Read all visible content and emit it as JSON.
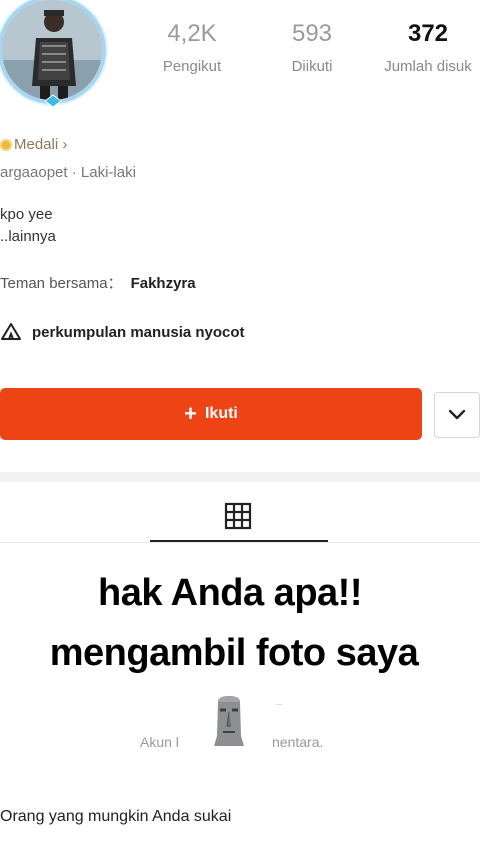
{
  "profile": {
    "stats": [
      {
        "value": "4,2K",
        "label": "Pengikut"
      },
      {
        "value": "593",
        "label": "Diikuti"
      },
      {
        "value": "372",
        "label": "Jumlah disuk"
      }
    ],
    "medal_label": "Medali ›",
    "meta": "argaaopet  ·  Laki-laki",
    "bio_line1": "kpo yee",
    "bio_line2": "..lainnya",
    "mutual_label": "Teman bersama：",
    "mutual_name": "Fakhzyra",
    "group_name": "perkumpulan manusia nyocot"
  },
  "actions": {
    "follow_label": "Ikuti",
    "follow_icon": "plus-icon",
    "dropdown_icon": "chevron-down-icon"
  },
  "tabs": {
    "active_icon": "grid-icon"
  },
  "overlay": {
    "line1": "hak Anda apa!!",
    "line2": "mengambil foto saya"
  },
  "private_notice": {
    "left": "Akun l",
    "right": "nentara."
  },
  "suggestions_title": "Orang yang mungkin Anda sukai",
  "colors": {
    "accent": "#ee4415",
    "avatar_ring": "#a9d6ef"
  }
}
